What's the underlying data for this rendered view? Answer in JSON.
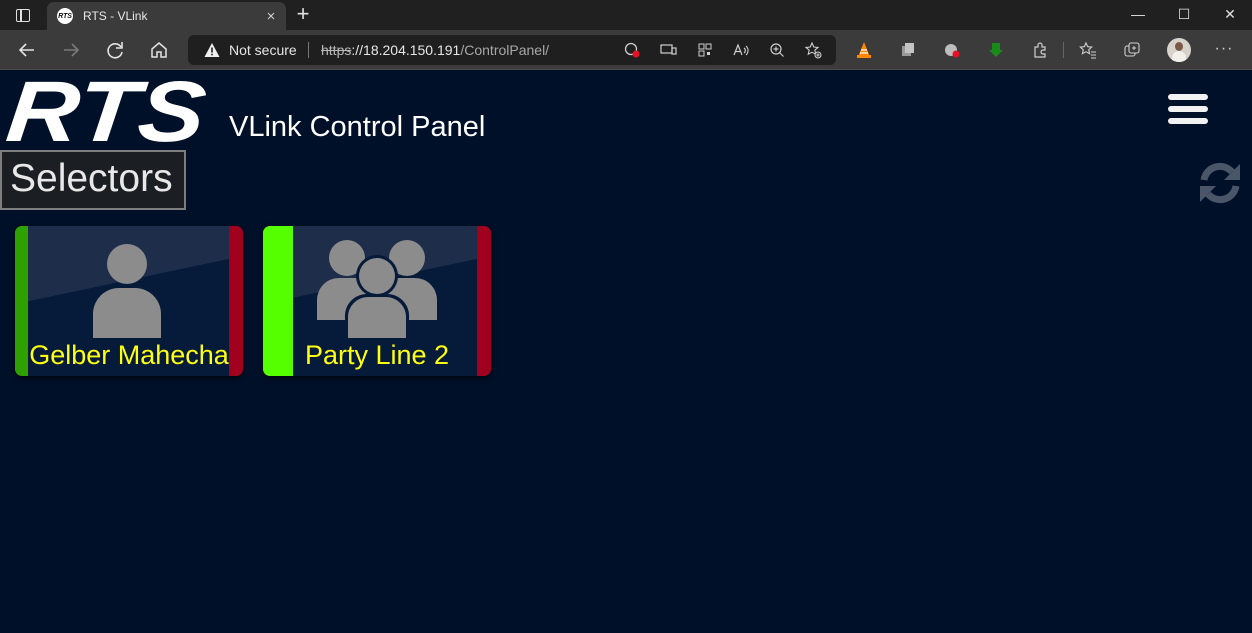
{
  "browser": {
    "tab_title": "RTS - VLink",
    "favicon_text": "RTS",
    "tab_close": "×",
    "new_tab": "+",
    "window_controls": {
      "minimize": "—",
      "maximize": "☐",
      "close": "✕"
    },
    "address": {
      "security_status": "Not secure",
      "url_scheme": "https",
      "url_host": "://18.204.150.191",
      "url_path": "/ControlPanel/"
    },
    "toolbar_icons": [
      "back-icon",
      "forward-icon",
      "refresh-icon",
      "home-icon"
    ],
    "more_menu": "···"
  },
  "app": {
    "logo_text": "RTS",
    "title": "VLink Control Panel",
    "selectors_label": "Selectors"
  },
  "selectors": [
    {
      "name": "Gelber Mahecha",
      "type": "user",
      "left_color": "#2ea000",
      "right_color": "#a0001e"
    },
    {
      "name": "Party Line 2",
      "type": "group",
      "left_color": "#55ff00",
      "right_color": "#a0001e"
    }
  ],
  "colors": {
    "page_background": "#001029",
    "label_text": "#ffff10",
    "icon_gray": "#8c8c8c"
  }
}
